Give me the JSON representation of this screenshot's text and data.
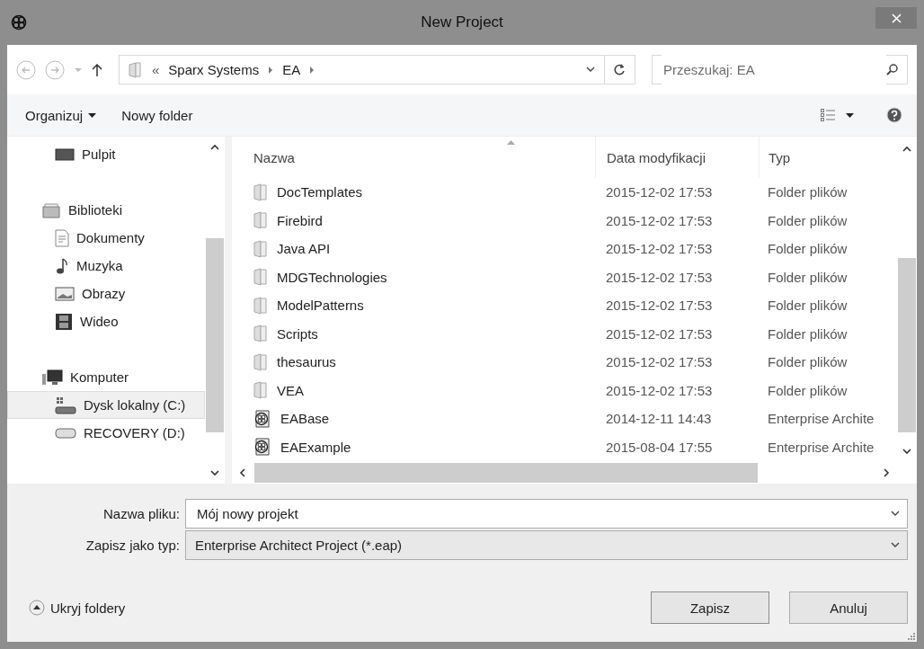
{
  "window": {
    "title": "New Project"
  },
  "navigation": {
    "path": [
      {
        "label": "«",
        "kind": "overflow"
      },
      {
        "label": "Sparx Systems",
        "kind": "crumb"
      },
      {
        "label": "EA",
        "kind": "crumb"
      }
    ],
    "search": {
      "placeholder": "Przeszukaj: EA"
    }
  },
  "toolbar": {
    "organize": "Organizuj",
    "new_folder": "Nowy folder"
  },
  "sidebar": {
    "items": [
      {
        "label": "Pulpit",
        "kind": "desktop",
        "selected": false
      },
      {
        "label": "Biblioteki",
        "kind": "library",
        "selected": false,
        "children": [
          {
            "label": "Dokumenty",
            "kind": "document",
            "selected": false
          },
          {
            "label": "Muzyka",
            "kind": "music",
            "selected": false
          },
          {
            "label": "Obrazy",
            "kind": "pictures",
            "selected": false
          },
          {
            "label": "Wideo",
            "kind": "video",
            "selected": false
          }
        ]
      },
      {
        "label": "Komputer",
        "kind": "computer",
        "selected": false,
        "children": [
          {
            "label": "Dysk lokalny (C:)",
            "kind": "system-drive",
            "selected": true
          },
          {
            "label": "RECOVERY (D:)",
            "kind": "drive",
            "selected": false
          }
        ]
      }
    ]
  },
  "table": {
    "columns": [
      "Nazwa",
      "Data modyfikacji",
      "Typ"
    ],
    "rows": [
      {
        "kind": "folder",
        "name": "DocTemplates",
        "modified": "2015-12-02 17:53",
        "type": "Folder plików"
      },
      {
        "kind": "folder",
        "name": "Firebird",
        "modified": "2015-12-02 17:53",
        "type": "Folder plików"
      },
      {
        "kind": "folder",
        "name": "Java API",
        "modified": "2015-12-02 17:53",
        "type": "Folder plików"
      },
      {
        "kind": "folder",
        "name": "MDGTechnologies",
        "modified": "2015-12-02 17:53",
        "type": "Folder plików"
      },
      {
        "kind": "folder",
        "name": "ModelPatterns",
        "modified": "2015-12-02 17:53",
        "type": "Folder plików"
      },
      {
        "kind": "folder",
        "name": "Scripts",
        "modified": "2015-12-02 17:53",
        "type": "Folder plików"
      },
      {
        "kind": "folder",
        "name": "thesaurus",
        "modified": "2015-12-02 17:53",
        "type": "Folder plików"
      },
      {
        "kind": "folder",
        "name": "VEA",
        "modified": "2015-12-02 17:53",
        "type": "Folder plików"
      },
      {
        "kind": "project",
        "name": "EABase",
        "modified": "2014-12-11 14:43",
        "type": "Enterprise Archite"
      },
      {
        "kind": "project",
        "name": "EAExample",
        "modified": "2015-08-04 17:55",
        "type": "Enterprise Archite"
      }
    ]
  },
  "form": {
    "file_name": {
      "label": "Nazwa pliku:",
      "value": "Mój nowy projekt"
    },
    "save_type": {
      "label": "Zapisz jako typ:",
      "value": "Enterprise Architect Project (*.eap)"
    }
  },
  "hide_folders": "Ukryj foldery",
  "buttons": [
    "Zapisz",
    "Anuluj"
  ]
}
